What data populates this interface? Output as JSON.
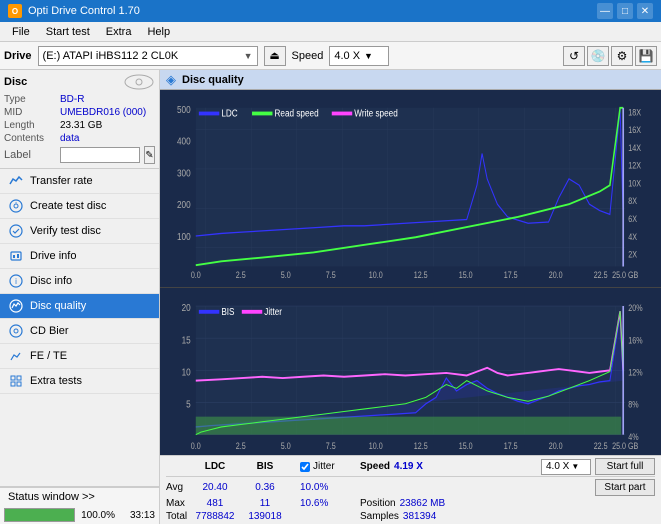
{
  "titlebar": {
    "title": "Opti Drive Control 1.70",
    "icon": "O",
    "minimize": "—",
    "maximize": "□",
    "close": "✕"
  },
  "menubar": {
    "items": [
      "File",
      "Start test",
      "Extra",
      "Help"
    ]
  },
  "drivebar": {
    "label": "Drive",
    "drive_text": "(E:)  ATAPI iHBS112  2 CL0K",
    "speed_label": "Speed",
    "speed_value": "4.0 X"
  },
  "disc_panel": {
    "title": "Disc",
    "type_label": "Type",
    "type_value": "BD-R",
    "mid_label": "MID",
    "mid_value": "UMEBDR016 (000)",
    "length_label": "Length",
    "length_value": "23.31 GB",
    "contents_label": "Contents",
    "contents_value": "data",
    "label_label": "Label"
  },
  "nav": {
    "items": [
      {
        "id": "transfer-rate",
        "label": "Transfer rate",
        "active": false
      },
      {
        "id": "create-test-disc",
        "label": "Create test disc",
        "active": false
      },
      {
        "id": "verify-test-disc",
        "label": "Verify test disc",
        "active": false
      },
      {
        "id": "drive-info",
        "label": "Drive info",
        "active": false
      },
      {
        "id": "disc-info",
        "label": "Disc info",
        "active": false
      },
      {
        "id": "disc-quality",
        "label": "Disc quality",
        "active": true
      },
      {
        "id": "cd-bier",
        "label": "CD Bier",
        "active": false
      },
      {
        "id": "fe-te",
        "label": "FE / TE",
        "active": false
      },
      {
        "id": "extra-tests",
        "label": "Extra tests",
        "active": false
      }
    ]
  },
  "status": {
    "window_label": "Status window >>",
    "progress": 100,
    "progress_text": "100.0%",
    "time": "33:13"
  },
  "disc_quality": {
    "title": "Disc quality",
    "icon": "◈",
    "legend_top": [
      {
        "label": "LDC",
        "color": "#4444ff"
      },
      {
        "label": "Read speed",
        "color": "#44ff44"
      },
      {
        "label": "Write speed",
        "color": "#ff44ff"
      }
    ],
    "legend_bottom": [
      {
        "label": "BIS",
        "color": "#4444ff"
      },
      {
        "label": "Jitter",
        "color": "#ff44ff"
      }
    ],
    "y_labels_top": [
      "500",
      "400",
      "300",
      "200",
      "100"
    ],
    "y_labels_top_right": [
      "18X",
      "16X",
      "14X",
      "12X",
      "10X",
      "8X",
      "6X",
      "4X",
      "2X"
    ],
    "x_labels": [
      "0.0",
      "2.5",
      "5.0",
      "7.5",
      "10.0",
      "12.5",
      "15.0",
      "17.5",
      "20.0",
      "22.5",
      "25.0 GB"
    ],
    "y_labels_bottom": [
      "20",
      "15",
      "10",
      "5"
    ],
    "y_labels_bottom_right": [
      "20%",
      "16%",
      "12%",
      "8%",
      "4%"
    ]
  },
  "stats": {
    "headers": [
      "",
      "LDC",
      "BIS",
      "",
      "Jitter",
      "Speed",
      "",
      ""
    ],
    "avg_label": "Avg",
    "avg_ldc": "20.40",
    "avg_bis": "0.36",
    "avg_jitter": "10.0%",
    "speed_val": "4.19 X",
    "speed_select": "4.0 X",
    "max_label": "Max",
    "max_ldc": "481",
    "max_bis": "11",
    "max_jitter": "10.6%",
    "position_label": "Position",
    "position_val": "23862 MB",
    "total_label": "Total",
    "total_ldc": "7788842",
    "total_bis": "139018",
    "samples_label": "Samples",
    "samples_val": "381394",
    "start_full_label": "Start full",
    "start_part_label": "Start part",
    "jitter_label": "Jitter",
    "jitter_checked": true
  }
}
